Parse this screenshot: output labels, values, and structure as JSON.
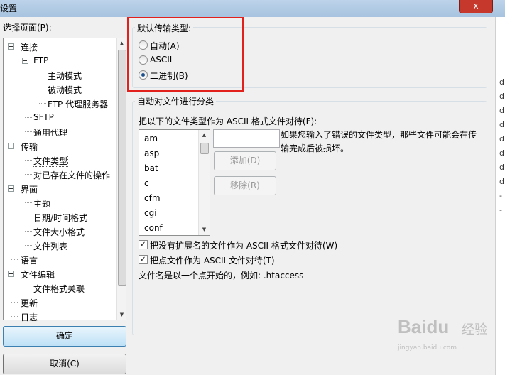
{
  "window": {
    "title": "设置"
  },
  "tree": {
    "label": "选择页面(P):",
    "items": [
      {
        "label": "连接"
      },
      {
        "label": "FTP"
      },
      {
        "label": "主动模式"
      },
      {
        "label": "被动模式"
      },
      {
        "label": "FTP 代理服务器"
      },
      {
        "label": "SFTP"
      },
      {
        "label": "通用代理"
      },
      {
        "label": "传输"
      },
      {
        "label": "文件类型"
      },
      {
        "label": "对已存在文件的操作"
      },
      {
        "label": "界面"
      },
      {
        "label": "主题"
      },
      {
        "label": "日期/时间格式"
      },
      {
        "label": "文件大小格式"
      },
      {
        "label": "文件列表"
      },
      {
        "label": "语言"
      },
      {
        "label": "文件编辑"
      },
      {
        "label": "文件格式关联"
      },
      {
        "label": "更新"
      },
      {
        "label": "日志"
      }
    ],
    "selected": "文件类型"
  },
  "buttons": {
    "ok": "确定",
    "cancel": "取消(C)",
    "add": "添加(D)",
    "remove": "移除(R)"
  },
  "default_type": {
    "title": "默认传输类型:",
    "options": [
      {
        "label": "自动(A)",
        "checked": false
      },
      {
        "label": "ASCII",
        "checked": false
      },
      {
        "label": "二进制(B)",
        "checked": true
      }
    ]
  },
  "auto_classify": {
    "title": "自动对文件进行分类",
    "list_label": "把以下的文件类型作为 ASCII 格式文件对待(F):",
    "extensions": [
      "am",
      "asp",
      "bat",
      "c",
      "cfm",
      "cgi",
      "conf"
    ],
    "input_value": "",
    "hint": "如果您输入了错误的文件类型，那些文件可能会在传输完成后被损坏。",
    "check_no_ext": {
      "label": "把没有扩展名的文件作为 ASCII 格式文件对待(W)",
      "checked": true
    },
    "check_dot": {
      "label": "把点文件作为 ASCII 文件对待(T)",
      "checked": true
    },
    "dot_note": "文件名是以一个点开始的，例如: .htaccess"
  },
  "background_strip": [
    "d",
    "d",
    "d",
    "d",
    "d",
    "d",
    "d",
    "d",
    "-",
    "-"
  ],
  "close_glyph": "x",
  "watermark": {
    "brand": "Baidu",
    "sub": "经验",
    "url": "jingyan.baidu.com"
  }
}
